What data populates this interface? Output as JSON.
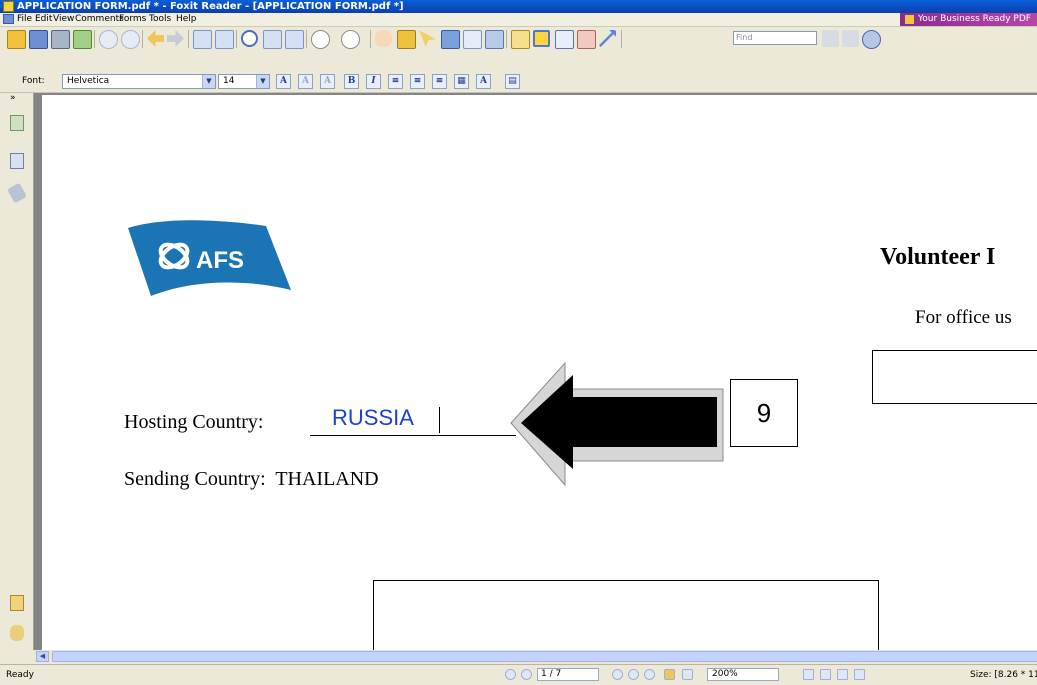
{
  "window": {
    "title": "APPLICATION FORM.pdf * - Foxit Reader - [APPLICATION FORM.pdf *]"
  },
  "menu": {
    "items": [
      "File",
      "Edit",
      "View",
      "Comments",
      "Forms",
      "Tools",
      "Help"
    ],
    "promo": "Your Business Ready PDF"
  },
  "toolbar": {
    "find_placeholder": "Find"
  },
  "font_toolbar": {
    "font_label": "Font:",
    "font_value": "Helvetica",
    "size_value": "14"
  },
  "document": {
    "heading": "Volunteer I",
    "office_use": "For office us",
    "logo_text": "AFS",
    "hosting_label": "Hosting Country:",
    "hosting_value": "RUSSIA",
    "sending_label": "Sending Country:",
    "sending_value": "THAILAND",
    "badge_number": "9"
  },
  "status": {
    "ready": "Ready",
    "page": "1 / 7",
    "zoom": "200%",
    "size": "Size: [8.26 * 11"
  },
  "colors": {
    "title_bar": "#0b4fc8",
    "logo_blue": "#1b74b4",
    "field_text": "#1f3fd0",
    "promo": "#a03c9c"
  }
}
